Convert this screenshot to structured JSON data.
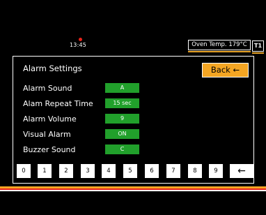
{
  "status_bar": {
    "time": "13:45",
    "oven_temp": "Oven Temp. 179°C",
    "tray_badge": "T1",
    "colors": {
      "indicator": "#e8231a",
      "underline": "#e9a52a"
    }
  },
  "panel": {
    "title": "Alarm Settings",
    "back_label": "Back ←",
    "back_color": "#f5a623",
    "value_color": "#21a02b",
    "rows": [
      {
        "label": "Alarm Sound",
        "value": "A"
      },
      {
        "label": "Alam Repeat Time",
        "value": "15 sec"
      },
      {
        "label": "Alarm Volume",
        "value": "9"
      },
      {
        "label": "Visual Alarm",
        "value": "ON"
      },
      {
        "label": "Buzzer Sound",
        "value": "C"
      }
    ]
  },
  "keypad": {
    "keys": [
      "0",
      "1",
      "2",
      "3",
      "4",
      "5",
      "6",
      "7",
      "8",
      "9"
    ],
    "backspace": "←"
  },
  "stripe_colors": [
    "#f5a623",
    "#e8231a",
    "#ffffff"
  ]
}
